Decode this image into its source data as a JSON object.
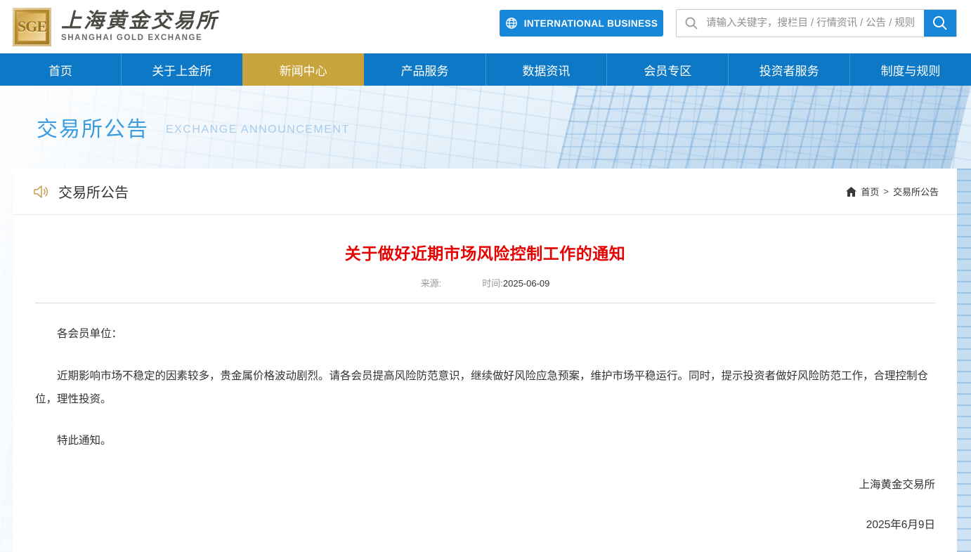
{
  "header": {
    "logo": {
      "badge": "SGE",
      "title_cn": "上海黄金交易所",
      "title_en": "SHANGHAI GOLD EXCHANGE"
    },
    "intl_button_label": "INTERNATIONAL BUSINESS",
    "search": {
      "placeholder": "请输入关键字，搜栏目 / 行情资讯 / 公告 / 规则",
      "value": ""
    }
  },
  "nav": {
    "items": [
      {
        "label": "首页",
        "active": false
      },
      {
        "label": "关于上金所",
        "active": false
      },
      {
        "label": "新闻中心",
        "active": true
      },
      {
        "label": "产品服务",
        "active": false
      },
      {
        "label": "数据资讯",
        "active": false
      },
      {
        "label": "会员专区",
        "active": false
      },
      {
        "label": "投资者服务",
        "active": false
      },
      {
        "label": "制度与规则",
        "active": false
      }
    ]
  },
  "banner": {
    "title": "交易所公告",
    "subtitle": "EXCHANGE ANNOUNCEMENT"
  },
  "content": {
    "section_title": "交易所公告",
    "breadcrumb": {
      "home": "首页",
      "separator": ">",
      "current": "交易所公告"
    },
    "article": {
      "title": "关于做好近期市场风险控制工作的通知",
      "source_label": "来源:",
      "time_label": "时间:",
      "time_value": "2025-06-09",
      "paragraphs": {
        "p1": "各会员单位：",
        "p2": "近期影响市场不稳定的因素较多，贵金属价格波动剧烈。请各会员提高风险防范意识，继续做好风险应急预案，维护市场平稳运行。同时，提示投资者做好风险防范工作，合理控制仓位，理性投资。",
        "p3": "特此通知。"
      },
      "signature": "上海黄金交易所",
      "date": "2025年6月9日"
    }
  },
  "colors": {
    "accent_blue": "#1687d9",
    "nav_blue": "#0d79c6",
    "active_gold": "#c9a33c",
    "title_red": "#e60000",
    "banner_blue": "#3b9ce0"
  }
}
